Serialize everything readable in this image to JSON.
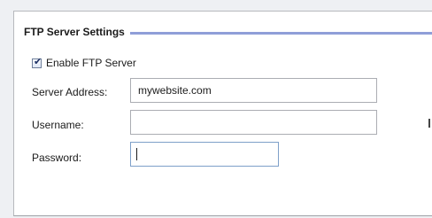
{
  "section": {
    "title": "FTP Server Settings",
    "accent_color": "#8f9ed8"
  },
  "enable_ftp": {
    "label": "Enable FTP Server",
    "checked": true
  },
  "fields": {
    "server_address": {
      "label": "Server Address:",
      "value": "mywebsite.com"
    },
    "username": {
      "label": "Username:",
      "value": ""
    },
    "password": {
      "label": "Password:",
      "value": ""
    }
  },
  "icons": {
    "checkbox": "checkmark-icon"
  }
}
